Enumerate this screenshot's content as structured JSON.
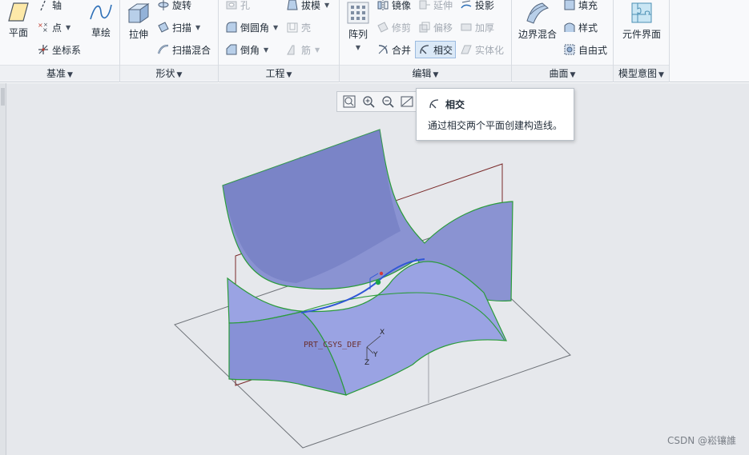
{
  "ribbon": {
    "groups": {
      "datum": {
        "label": "基准",
        "plane": "平面",
        "axis": "轴",
        "point": "点",
        "csys": "坐标系",
        "sketch": "草绘"
      },
      "shapes": {
        "label": "形状",
        "extrude": "拉伸",
        "revolve": "旋转",
        "sweep": "扫描",
        "swept_blend": "扫描混合"
      },
      "engineering": {
        "label": "工程",
        "hole": "孔",
        "round": "倒圆角",
        "chamfer": "倒角",
        "draft": "拔模",
        "shell": "壳",
        "rib": "筋"
      },
      "editing": {
        "label": "编辑",
        "pattern": "阵列",
        "mirror": "镜像",
        "extend": "延伸",
        "project": "投影",
        "trim": "修剪",
        "offset": "偏移",
        "thicken": "加厚",
        "merge": "合并",
        "intersect": "相交",
        "solidify": "实体化"
      },
      "surfaces": {
        "label": "曲面",
        "boundary_blend": "边界混合",
        "fill": "填充",
        "style": "样式",
        "freestyle": "自由式"
      },
      "model_intent": {
        "label": "模型意图",
        "component_interface": "元件界面"
      }
    }
  },
  "tooltip": {
    "title": "相交",
    "description": "通过相交两个平面创建构造线。"
  },
  "model": {
    "csys_label": "PRT_CSYS_DEF",
    "axis_x": "X",
    "axis_y": "Y",
    "axis_z": "Z"
  },
  "watermark": "CSDN @崧镶誰",
  "colors": {
    "surface_fill": "#8e97d6",
    "surface_edge": "#2a9b3a",
    "intersection_curve": "#2f56d6",
    "datum_plane_front": "#7a2a2a",
    "datum_plane_other": "#6f7379",
    "accent_active": "#dbe9f7"
  }
}
